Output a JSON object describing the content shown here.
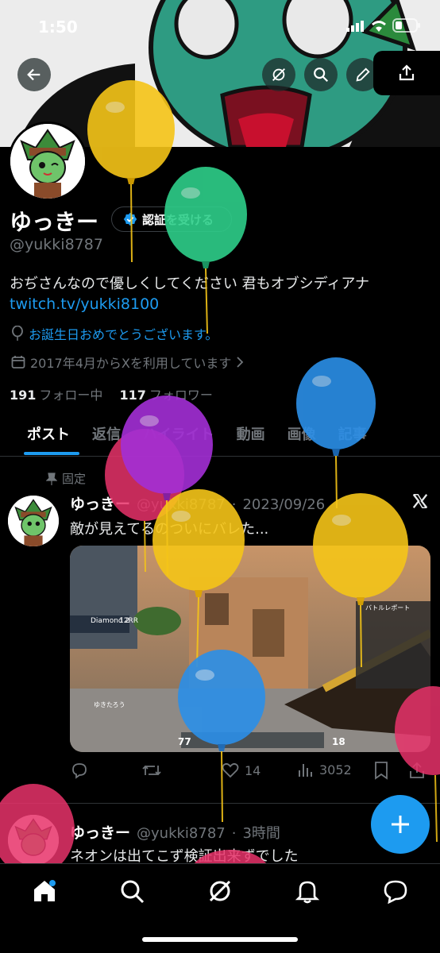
{
  "status": {
    "time": "1:50"
  },
  "profile": {
    "name": "ゆっきー",
    "verify_label": "認証を受ける",
    "handle": "@yukki8787",
    "bio": "おぢさんなので優しくしてください 君もオブシディアナ",
    "link": "twitch.tv/yukki8100",
    "birthday": "お誕生日おめでとうございます。",
    "joined": "2017年4月からXを利用しています",
    "following_count": "191",
    "following_label": "フォロー中",
    "followers_count": "117",
    "followers_label": "フォロワー"
  },
  "tabs": [
    "ポスト",
    "返信",
    "ハイライト",
    "動画",
    "画像",
    "記事"
  ],
  "pinned_label": "固定",
  "tweets": [
    {
      "name": "ゆっきー",
      "handle": "@yukki8787",
      "sep": "·",
      "time": "2023/09/26",
      "text": "敵が見えてるのついにバレた...",
      "replies": "",
      "retweets": "",
      "likes": "14",
      "views": "3052",
      "media_overlay": {
        "rank": "Diamond 2",
        "rr": "12RR",
        "player": "ゆきたろう",
        "hp": "77",
        "ammo": "18",
        "report": "バトルレポート"
      }
    },
    {
      "name": "ゆっきー",
      "handle": "@yukki8787",
      "sep": "·",
      "time": "3時間",
      "text": "ネオンは出てこず検証出来ずでした"
    }
  ],
  "icons": {
    "back": "arrow-left-icon",
    "grok": "grok-icon",
    "search": "search-icon",
    "edit": "pen-icon",
    "share": "share-icon",
    "verified": "verified-badge-icon",
    "balloon": "balloon-icon",
    "calendar": "calendar-icon",
    "pin": "pin-icon",
    "x_logo": "x-logo-icon",
    "reply": "reply-icon",
    "retweet": "retweet-icon",
    "like": "heart-icon",
    "views": "views-icon",
    "bookmark": "bookmark-icon",
    "compose": "plus-icon",
    "nav_home": "home-icon",
    "nav_search": "search-icon",
    "nav_grok": "grok-icon",
    "nav_notifications": "bell-icon",
    "nav_messages": "message-icon"
  },
  "colors": {
    "accent": "#1d9bf0",
    "background": "#000000",
    "muted": "#71767b",
    "balloon_yellow": "#f5c518",
    "balloon_green": "#2ecf8a",
    "balloon_blue": "#2b8fe8",
    "balloon_purple": "#a32fd6",
    "balloon_red": "#e8326a"
  }
}
